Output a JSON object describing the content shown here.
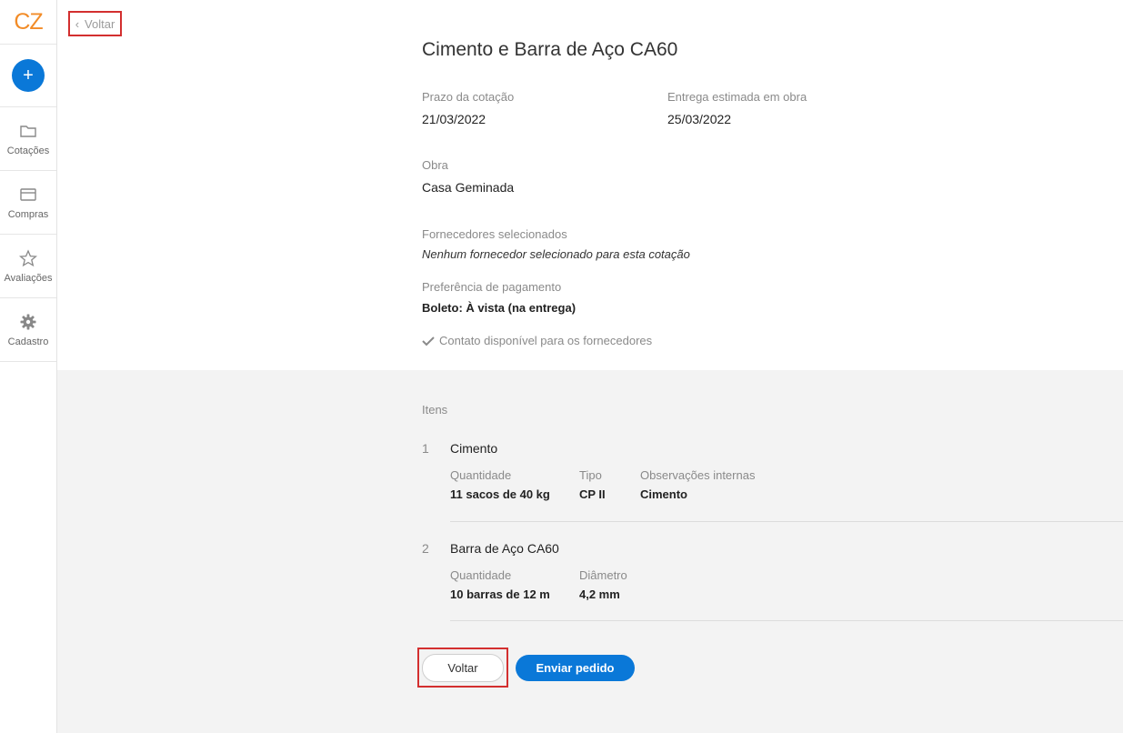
{
  "sidebar": {
    "logo": "CZ",
    "add_symbol": "+",
    "items": [
      {
        "label": "Cotações",
        "icon": "folder-icon"
      },
      {
        "label": "Compras",
        "icon": "card-icon"
      },
      {
        "label": "Avaliações",
        "icon": "star-icon"
      },
      {
        "label": "Cadastro",
        "icon": "gear-icon"
      }
    ]
  },
  "header": {
    "back_label": "Voltar"
  },
  "quote": {
    "title": "Cimento e Barra de Aço CA60",
    "deadline_label": "Prazo da cotação",
    "deadline_value": "21/03/2022",
    "delivery_label": "Entrega estimada em obra",
    "delivery_value": "25/03/2022",
    "site_label": "Obra",
    "site_value": "Casa Geminada",
    "suppliers_label": "Fornecedores selecionados",
    "suppliers_value": "Nenhum fornecedor selecionado para esta cotação",
    "payment_label": "Preferência de pagamento",
    "payment_value": "Boleto: À vista (na entrega)",
    "contact_text": "Contato disponível para os fornecedores"
  },
  "items_section": {
    "label": "Itens",
    "items": [
      {
        "number": "1",
        "name": "Cimento",
        "fields": [
          {
            "label": "Quantidade",
            "value": "11 sacos de 40 kg"
          },
          {
            "label": "Tipo",
            "value": "CP II"
          },
          {
            "label": "Observações internas",
            "value": "Cimento"
          }
        ]
      },
      {
        "number": "2",
        "name": "Barra de Aço CA60",
        "fields": [
          {
            "label": "Quantidade",
            "value": "10 barras de 12 m"
          },
          {
            "label": "Diâmetro",
            "value": "4,2 mm"
          }
        ]
      }
    ]
  },
  "actions": {
    "back_label": "Voltar",
    "submit_label": "Enviar pedido"
  },
  "colors": {
    "primary": "#0a78d8",
    "logo": "#f28c28",
    "highlight": "#d32f2f"
  }
}
